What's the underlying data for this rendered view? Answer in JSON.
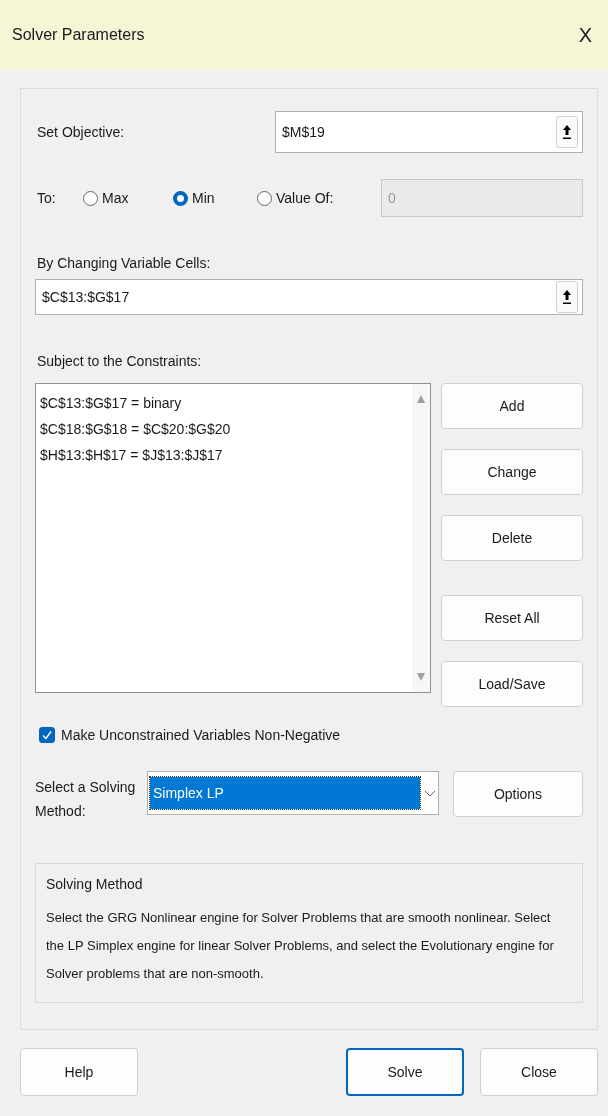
{
  "window": {
    "title": "Solver Parameters",
    "close": "X"
  },
  "objective": {
    "label": "Set Objective:",
    "value": "$M$19"
  },
  "to": {
    "label": "To:",
    "options": [
      {
        "label": "Max",
        "selected": false
      },
      {
        "label": "Min",
        "selected": true
      },
      {
        "label": "Value Of:",
        "selected": false
      }
    ],
    "value_field": {
      "value": "0",
      "disabled": true
    }
  },
  "variable_cells": {
    "label": "By Changing Variable Cells:",
    "value": "$C$13:$G$17"
  },
  "constraints": {
    "label": "Subject to the Constraints:",
    "items": [
      "$C$13:$G$17 = binary",
      "$C$18:$G$18 = $C$20:$G$20",
      "$H$13:$H$17 = $J$13:$J$17"
    ],
    "buttons": [
      "Add",
      "Change",
      "Delete",
      "Reset All",
      "Load/Save"
    ]
  },
  "nonnegative": {
    "label": "Make Unconstrained Variables Non-Negative",
    "checked": true
  },
  "method": {
    "label": "Select a Solving Method:",
    "value": "Simplex LP",
    "options_button": "Options"
  },
  "info": {
    "title": "Solving Method",
    "text": "Select the GRG Nonlinear engine for Solver Problems that are smooth nonlinear. Select the LP Simplex engine for linear Solver Problems, and select the Evolutionary engine for Solver problems that are non-smooth."
  },
  "footer_buttons": [
    {
      "label": "Help",
      "default": false
    },
    {
      "label": "Solve",
      "default": true
    },
    {
      "label": "Close",
      "default": false
    }
  ]
}
